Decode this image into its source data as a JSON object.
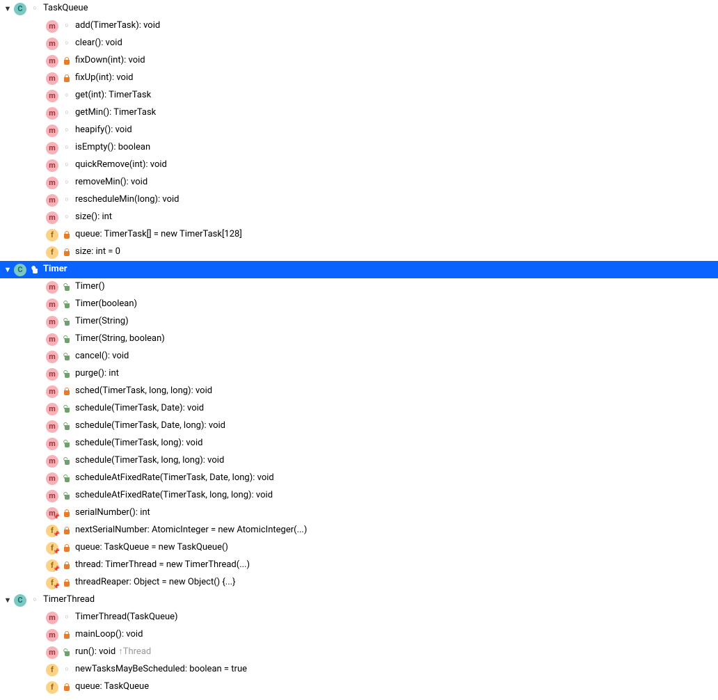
{
  "classes": [
    {
      "name": "TaskQueue",
      "icon": "class",
      "vis": "package",
      "selected": false,
      "overlay": "",
      "members": [
        {
          "icon": "method",
          "vis": "package",
          "label": "add(TimerTask): void",
          "extra": ""
        },
        {
          "icon": "method",
          "vis": "package",
          "label": "clear(): void",
          "extra": ""
        },
        {
          "icon": "method",
          "vis": "private",
          "label": "fixDown(int): void",
          "extra": ""
        },
        {
          "icon": "method",
          "vis": "private",
          "label": "fixUp(int): void",
          "extra": ""
        },
        {
          "icon": "method",
          "vis": "package",
          "label": "get(int): TimerTask",
          "extra": ""
        },
        {
          "icon": "method",
          "vis": "package",
          "label": "getMin(): TimerTask",
          "extra": ""
        },
        {
          "icon": "method",
          "vis": "package",
          "label": "heapify(): void",
          "extra": ""
        },
        {
          "icon": "method",
          "vis": "package",
          "label": "isEmpty(): boolean",
          "extra": ""
        },
        {
          "icon": "method",
          "vis": "package",
          "label": "quickRemove(int): void",
          "extra": ""
        },
        {
          "icon": "method",
          "vis": "package",
          "label": "removeMin(): void",
          "extra": ""
        },
        {
          "icon": "method",
          "vis": "package",
          "label": "rescheduleMin(long): void",
          "extra": ""
        },
        {
          "icon": "method",
          "vis": "package",
          "label": "size(): int",
          "extra": ""
        },
        {
          "icon": "field",
          "vis": "private",
          "label": "queue: TimerTask[] = new TimerTask[128]",
          "extra": ""
        },
        {
          "icon": "field",
          "vis": "private",
          "label": "size: int = 0",
          "extra": ""
        }
      ]
    },
    {
      "name": "Timer",
      "icon": "class",
      "vis": "public",
      "selected": true,
      "overlay": "",
      "members": [
        {
          "icon": "method",
          "vis": "public",
          "label": "Timer()",
          "extra": ""
        },
        {
          "icon": "method",
          "vis": "public",
          "label": "Timer(boolean)",
          "extra": ""
        },
        {
          "icon": "method",
          "vis": "public",
          "label": "Timer(String)",
          "extra": ""
        },
        {
          "icon": "method",
          "vis": "public",
          "label": "Timer(String, boolean)",
          "extra": ""
        },
        {
          "icon": "method",
          "vis": "public",
          "label": "cancel(): void",
          "extra": ""
        },
        {
          "icon": "method",
          "vis": "public",
          "label": "purge(): int",
          "extra": ""
        },
        {
          "icon": "method",
          "vis": "private",
          "label": "sched(TimerTask, long, long): void",
          "extra": ""
        },
        {
          "icon": "method",
          "vis": "public",
          "label": "schedule(TimerTask, Date): void",
          "extra": ""
        },
        {
          "icon": "method",
          "vis": "public",
          "label": "schedule(TimerTask, Date, long): void",
          "extra": ""
        },
        {
          "icon": "method",
          "vis": "public",
          "label": "schedule(TimerTask, long): void",
          "extra": ""
        },
        {
          "icon": "method",
          "vis": "public",
          "label": "schedule(TimerTask, long, long): void",
          "extra": ""
        },
        {
          "icon": "method",
          "vis": "public",
          "label": "scheduleAtFixedRate(TimerTask, Date, long): void",
          "extra": ""
        },
        {
          "icon": "method",
          "vis": "public",
          "label": "scheduleAtFixedRate(TimerTask, long, long): void",
          "extra": ""
        },
        {
          "icon": "method",
          "vis": "private",
          "label": "serialNumber(): int",
          "extra": "",
          "overlay": "pin"
        },
        {
          "icon": "field",
          "vis": "private",
          "label": "nextSerialNumber: AtomicInteger = new AtomicInteger(...)",
          "extra": "",
          "overlay": "pin"
        },
        {
          "icon": "field",
          "vis": "private",
          "label": "queue: TaskQueue = new TaskQueue()",
          "extra": "",
          "overlay": "pin"
        },
        {
          "icon": "field",
          "vis": "private",
          "label": "thread: TimerThread = new TimerThread(...)",
          "extra": "",
          "overlay": "pin"
        },
        {
          "icon": "field",
          "vis": "private",
          "label": "threadReaper: Object = new Object() {...}",
          "extra": "",
          "overlay": "pin"
        }
      ]
    },
    {
      "name": "TimerThread",
      "icon": "class",
      "vis": "package",
      "selected": false,
      "overlay": "",
      "members": [
        {
          "icon": "method",
          "vis": "package",
          "label": "TimerThread(TaskQueue)",
          "extra": ""
        },
        {
          "icon": "method",
          "vis": "private",
          "label": "mainLoop(): void",
          "extra": ""
        },
        {
          "icon": "method",
          "vis": "public",
          "label": "run(): void",
          "extra": "↑Thread"
        },
        {
          "icon": "field",
          "vis": "package",
          "label": "newTasksMayBeScheduled: boolean = true",
          "extra": ""
        },
        {
          "icon": "field",
          "vis": "private",
          "label": "queue: TaskQueue",
          "extra": ""
        }
      ]
    }
  ],
  "iconLetters": {
    "class": "C",
    "method": "m",
    "field": "f"
  }
}
